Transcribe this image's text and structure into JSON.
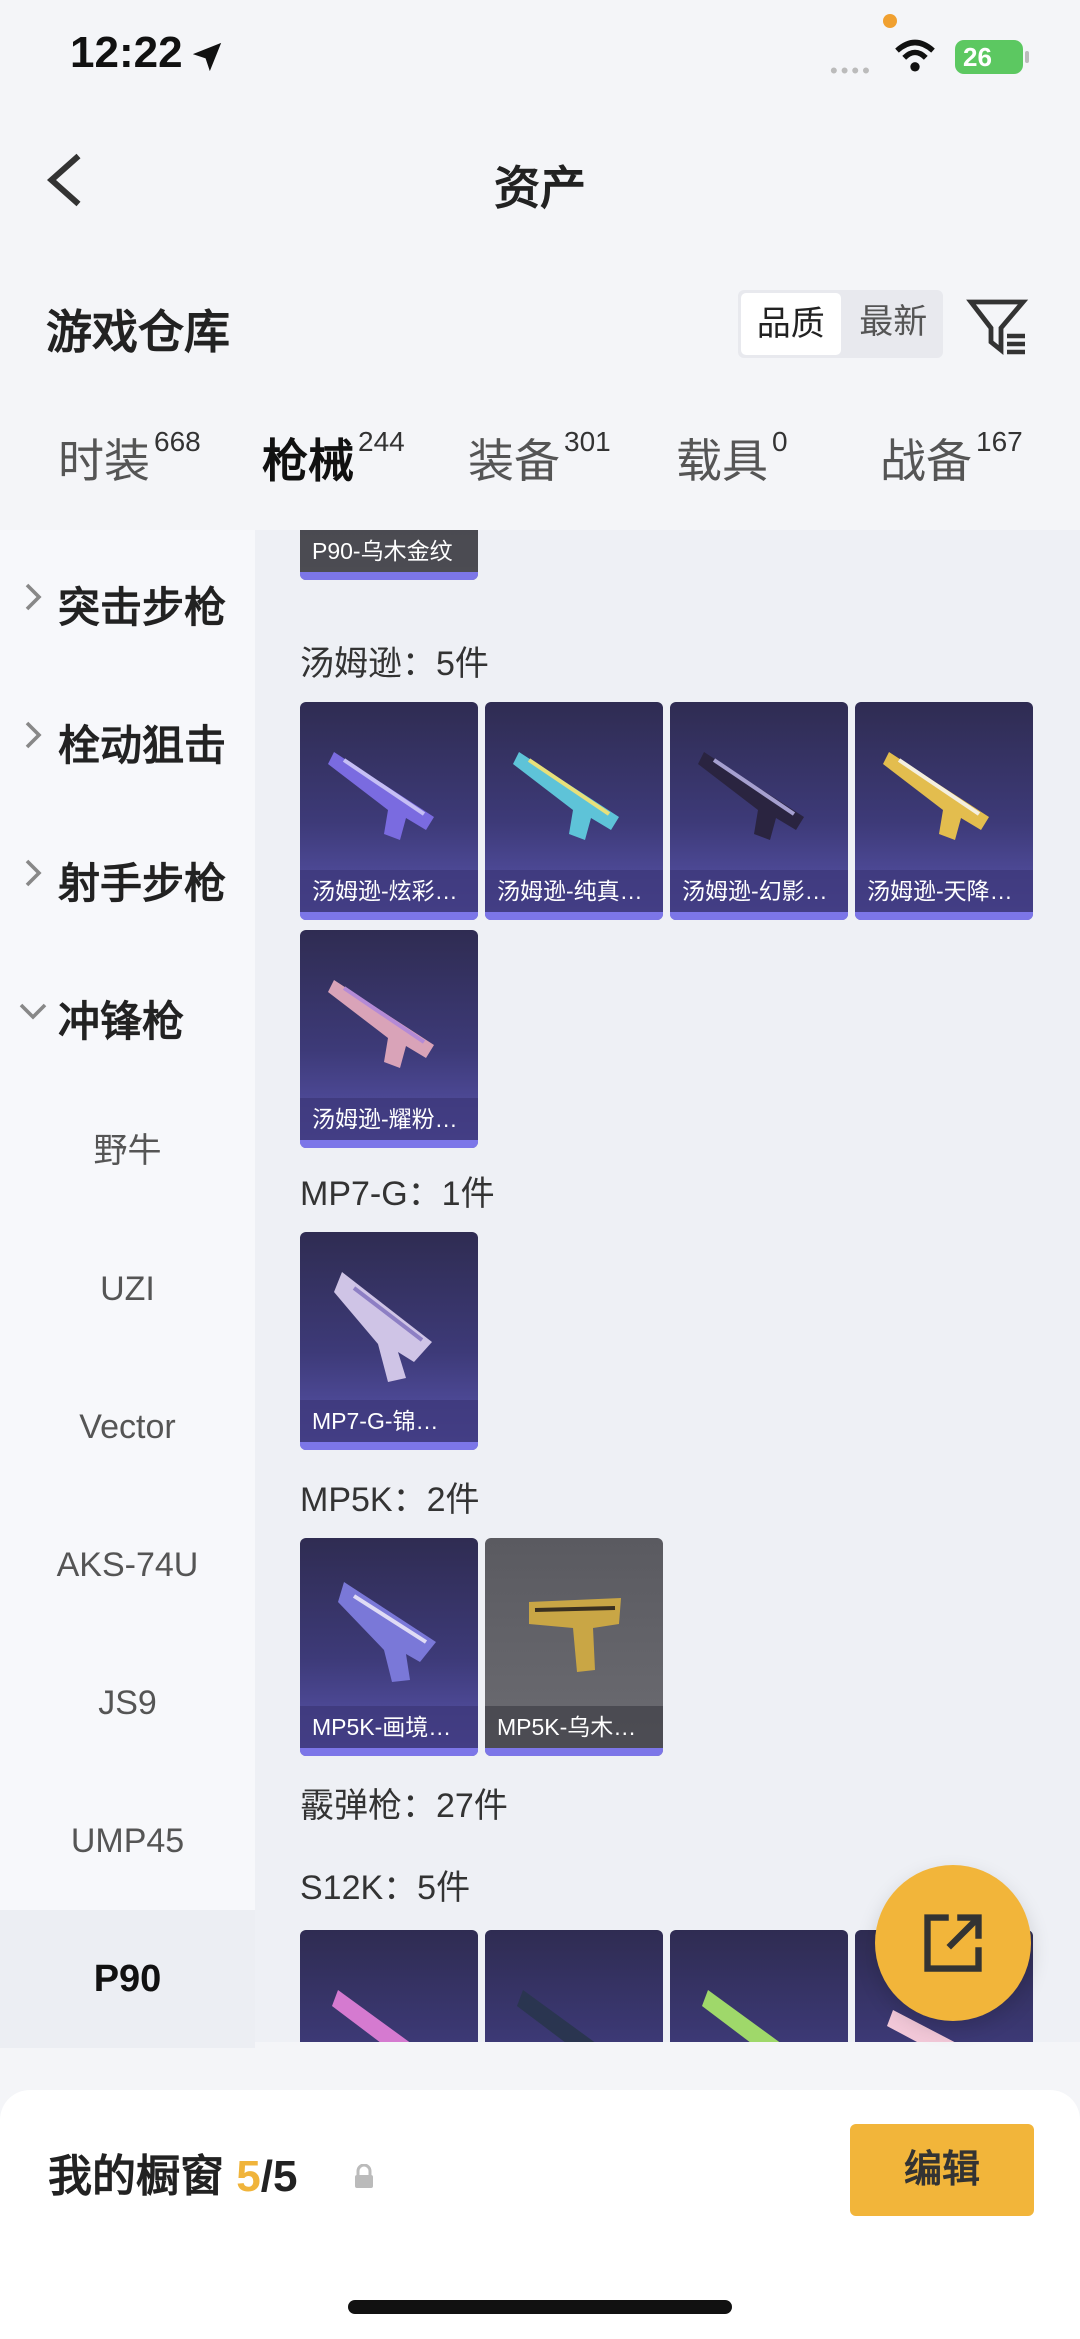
{
  "status_bar": {
    "time": "12:22",
    "battery": "26"
  },
  "nav": {
    "title": "资产"
  },
  "section": {
    "title": "游戏仓库",
    "sort_options": [
      "品质",
      "最新"
    ]
  },
  "tabs": [
    {
      "label": "时装",
      "count": "668"
    },
    {
      "label": "枪械",
      "count": "244"
    },
    {
      "label": "装备",
      "count": "301"
    },
    {
      "label": "载具",
      "count": "0"
    },
    {
      "label": "战备",
      "count": "167"
    }
  ],
  "sidebar": {
    "categories": [
      "突击步枪",
      "栓动狙击",
      "射手步枪",
      "冲锋枪"
    ],
    "subs": [
      "野牛",
      "UZI",
      "Vector",
      "AKS-74U",
      "JS9",
      "UMP45",
      "P90"
    ]
  },
  "content": {
    "top_card": "P90-乌木金纹",
    "thompson": {
      "label": "汤姆逊：5件",
      "items": [
        "汤姆逊-炫彩…",
        "汤姆逊-纯真…",
        "汤姆逊-幻影…",
        "汤姆逊-天降…",
        "汤姆逊-耀粉…"
      ]
    },
    "mp7": {
      "label": "MP7-G：1件",
      "items": [
        "MP7-G-锦…"
      ]
    },
    "mp5k": {
      "label": "MP5K：2件",
      "items": [
        "MP5K-画境…",
        "MP5K-乌木…"
      ]
    },
    "shotgun": {
      "label": "霰弹枪：27件"
    },
    "s12k": {
      "label": "S12K：5件"
    }
  },
  "bottom": {
    "label": "我的橱窗",
    "count_current": "5",
    "count_total": "/5",
    "edit": "编辑"
  },
  "colors": {
    "accent": "#f2b53a",
    "card": "#3d3a78",
    "card_bar": "#7c76e8"
  },
  "icons": [
    "location-arrow-icon",
    "wifi-icon",
    "back-icon",
    "filter-icon",
    "chevron-right-icon",
    "chevron-down-icon",
    "share-icon",
    "lock-icon",
    "gun-icon"
  ]
}
